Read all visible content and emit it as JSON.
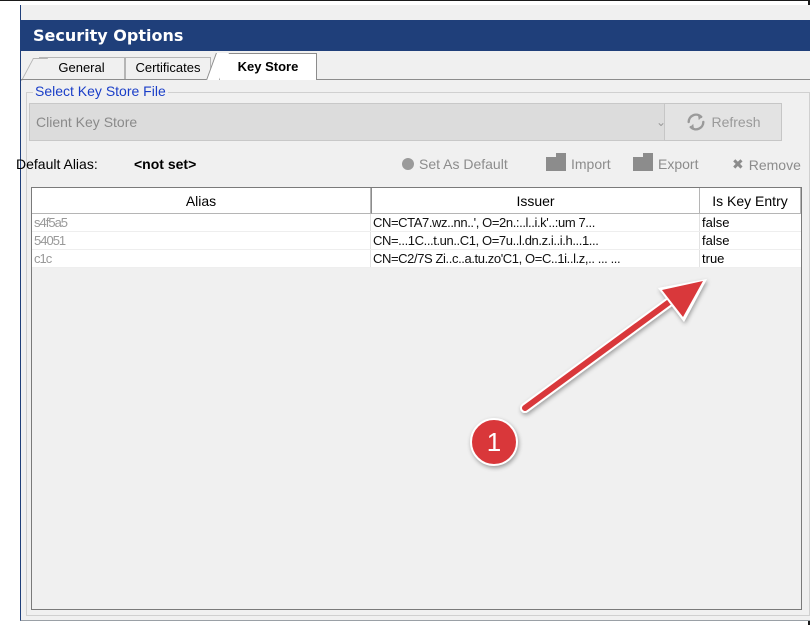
{
  "window": {
    "title": "Security Options"
  },
  "tabs": [
    {
      "label": "General",
      "selected": false
    },
    {
      "label": "Certificates",
      "selected": false
    },
    {
      "label": "Key Store",
      "selected": true
    }
  ],
  "keystore_group": {
    "legend": "Select Key Store File",
    "combo_value": "Client Key Store",
    "refresh_label": "Refresh"
  },
  "alias_bar": {
    "label": "Default Alias:",
    "value": "<not set>"
  },
  "toolbar": {
    "set_default_label": "Set As Default",
    "import_label": "Import",
    "export_label": "Export",
    "remove_label": "Remove"
  },
  "table": {
    "columns": [
      "Alias",
      "Issuer",
      "Is Key Entry"
    ],
    "rows": [
      {
        "alias": "s4f5a5",
        "issuer": "CN=CTA7.wz..nn..', O=2n.:..l..i.k'..:um 7...",
        "is_key_entry": "false"
      },
      {
        "alias": "54051",
        "issuer": "CN=...1C...t.un..C1, O=7u..l.dn.z.i..i.h...1...",
        "is_key_entry": "false"
      },
      {
        "alias": "c1c",
        "issuer": "CN=C2/7S Zi..c..a.tu.zo'C1, O=C..1i..l.z,.. ...  ...",
        "is_key_entry": "true"
      }
    ]
  },
  "annotation": {
    "badge_number": "1",
    "color": "#d9373a"
  },
  "colors": {
    "titlebar": "#1f3f7a",
    "legend_text": "#1a3ec8"
  }
}
